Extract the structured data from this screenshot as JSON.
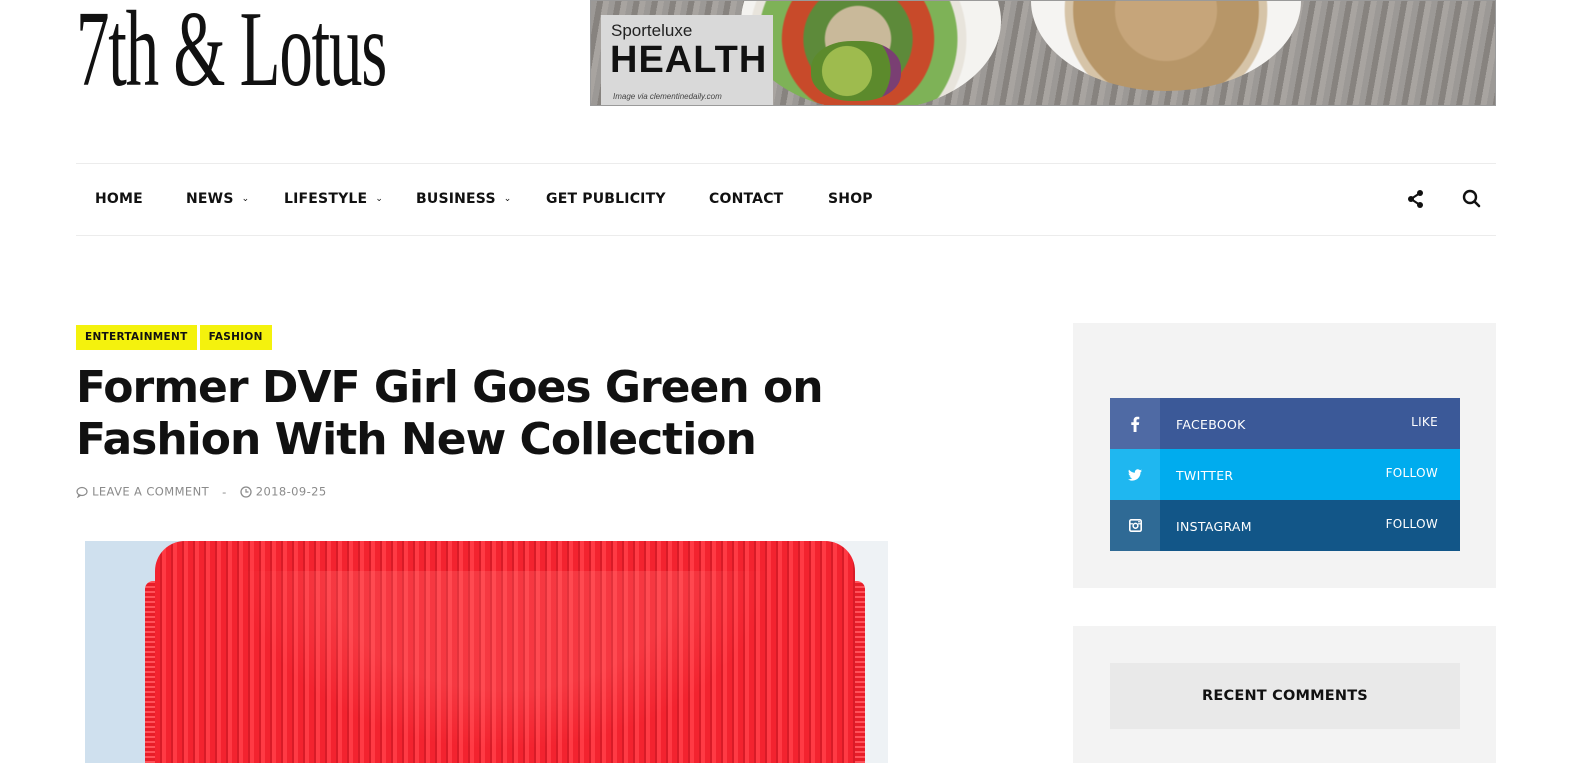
{
  "site": {
    "logo_text": "7th & Lotus"
  },
  "banner": {
    "brand": "Sporteluxe",
    "headline": "HEALTH",
    "credit": "Image via clementinedaily.com"
  },
  "nav": {
    "items": [
      {
        "label": "HOME",
        "has_dropdown": false
      },
      {
        "label": "NEWS",
        "has_dropdown": true
      },
      {
        "label": "LIFESTYLE",
        "has_dropdown": true
      },
      {
        "label": "BUSINESS",
        "has_dropdown": true
      },
      {
        "label": "GET PUBLICITY",
        "has_dropdown": false
      },
      {
        "label": "CONTACT",
        "has_dropdown": false
      },
      {
        "label": "SHOP",
        "has_dropdown": false
      }
    ],
    "chevron": "⌄",
    "icons": [
      "share-icon",
      "search-icon"
    ]
  },
  "article": {
    "categories": [
      "ENTERTAINMENT",
      "FASHION"
    ],
    "title": "Former DVF Girl Goes Green on Fashion With New Collection",
    "meta": {
      "comments": "LEAVE A COMMENT",
      "separator": "-",
      "date": "2018-09-25"
    }
  },
  "sidebar": {
    "social": [
      {
        "network": "FACEBOOK",
        "action": "LIKE",
        "icon": "facebook-icon",
        "color": "#3b5998"
      },
      {
        "network": "TWITTER",
        "action": "FOLLOW",
        "icon": "twitter-icon",
        "color": "#00acee"
      },
      {
        "network": "INSTAGRAM",
        "action": "FOLLOW",
        "icon": "instagram-icon",
        "color": "#125688"
      }
    ],
    "recent_comments_title": "RECENT COMMENTS"
  },
  "colors": {
    "category_badge": "#f4f20d",
    "text": "#111111",
    "meta": "#8b8b8b",
    "widget_bg": "#f3f3f3"
  }
}
